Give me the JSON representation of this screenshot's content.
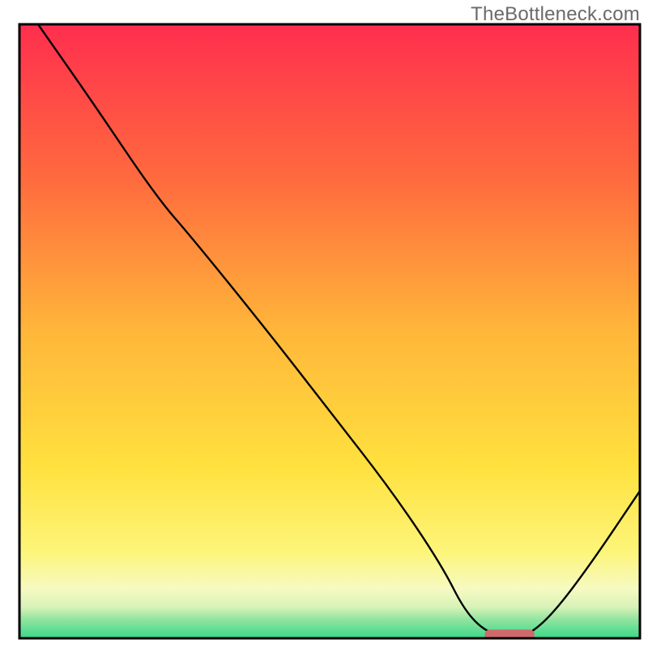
{
  "watermark": "TheBottleneck.com",
  "chart_data": {
    "type": "line",
    "title": "",
    "xlabel": "",
    "ylabel": "",
    "xlim": [
      0,
      100
    ],
    "ylim": [
      0,
      100
    ],
    "series": [
      {
        "name": "bottleneck-curve",
        "x": [
          3,
          12,
          22,
          28,
          40,
          50,
          60,
          68,
          72,
          76,
          80,
          82,
          86,
          92,
          100
        ],
        "y": [
          100,
          87,
          72,
          65,
          50,
          37,
          24,
          12,
          4,
          0.5,
          0.5,
          0.5,
          4,
          12,
          24
        ]
      }
    ],
    "marker": {
      "x_center": 79,
      "x_halfwidth": 4,
      "y": 0.5,
      "color": "#cf6a6c"
    },
    "gradient_stops": [
      {
        "pct": 0,
        "color": "#ff2e4e"
      },
      {
        "pct": 25,
        "color": "#ff6a3e"
      },
      {
        "pct": 50,
        "color": "#ffb63a"
      },
      {
        "pct": 72,
        "color": "#ffe13e"
      },
      {
        "pct": 86,
        "color": "#fdf57a"
      },
      {
        "pct": 92,
        "color": "#f6fac2"
      },
      {
        "pct": 95,
        "color": "#d6f2b6"
      },
      {
        "pct": 97,
        "color": "#8fe49e"
      },
      {
        "pct": 100,
        "color": "#39d889"
      }
    ],
    "frame": {
      "stroke": "#000000",
      "width": 3
    }
  }
}
